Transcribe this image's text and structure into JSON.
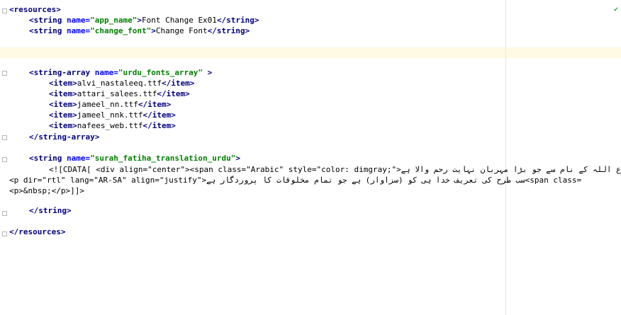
{
  "editor": {
    "lines": [
      {
        "id": "l1",
        "indent": 0,
        "parts": [
          {
            "k": "tag",
            "t": "<resources>"
          }
        ]
      },
      {
        "id": "l2",
        "indent": 4,
        "parts": [
          {
            "k": "tag",
            "t": "<string "
          },
          {
            "k": "attr",
            "t": "name="
          },
          {
            "k": "val",
            "t": "\"app_name\""
          },
          {
            "k": "tag",
            "t": ">"
          },
          {
            "k": "txt",
            "t": "Font Change Ex01"
          },
          {
            "k": "tag",
            "t": "</string>"
          }
        ]
      },
      {
        "id": "l3",
        "indent": 4,
        "parts": [
          {
            "k": "tag",
            "t": "<string "
          },
          {
            "k": "attr",
            "t": "name="
          },
          {
            "k": "val",
            "t": "\"change_font\""
          },
          {
            "k": "tag",
            "t": ">"
          },
          {
            "k": "txt",
            "t": "Change Font"
          },
          {
            "k": "tag",
            "t": "</string>"
          }
        ]
      },
      {
        "id": "l4",
        "indent": 0,
        "parts": []
      },
      {
        "id": "l5",
        "indent": 0,
        "parts": []
      },
      {
        "id": "l6",
        "indent": 0,
        "parts": []
      },
      {
        "id": "l7",
        "indent": 4,
        "parts": [
          {
            "k": "tag",
            "t": "<string-array "
          },
          {
            "k": "attr",
            "t": "name="
          },
          {
            "k": "val",
            "t": "\"urdu_fonts_array\""
          },
          {
            "k": "tag",
            "t": " >"
          }
        ]
      },
      {
        "id": "l8",
        "indent": 8,
        "parts": [
          {
            "k": "tag",
            "t": "<item>"
          },
          {
            "k": "txt",
            "t": "alvi_nastaleeq.ttf"
          },
          {
            "k": "tag",
            "t": "</item>"
          }
        ]
      },
      {
        "id": "l9",
        "indent": 8,
        "parts": [
          {
            "k": "tag",
            "t": "<item>"
          },
          {
            "k": "txt",
            "t": "attari_salees.ttf"
          },
          {
            "k": "tag",
            "t": "</item>"
          }
        ]
      },
      {
        "id": "l10",
        "indent": 8,
        "parts": [
          {
            "k": "tag",
            "t": "<item>"
          },
          {
            "k": "txt",
            "t": "jameel_nn.ttf"
          },
          {
            "k": "tag",
            "t": "</item>"
          }
        ]
      },
      {
        "id": "l11",
        "indent": 8,
        "parts": [
          {
            "k": "tag",
            "t": "<item>"
          },
          {
            "k": "txt",
            "t": "jameel_nnk.ttf"
          },
          {
            "k": "tag",
            "t": "</item>"
          }
        ]
      },
      {
        "id": "l12",
        "indent": 8,
        "parts": [
          {
            "k": "tag",
            "t": "<item>"
          },
          {
            "k": "txt",
            "t": "nafees_web.ttf"
          },
          {
            "k": "tag",
            "t": "</item>"
          }
        ]
      },
      {
        "id": "l13",
        "indent": 4,
        "parts": [
          {
            "k": "tag",
            "t": "</string-array>"
          }
        ]
      },
      {
        "id": "l14",
        "indent": 0,
        "parts": []
      },
      {
        "id": "l15",
        "indent": 4,
        "parts": [
          {
            "k": "tag",
            "t": "<string "
          },
          {
            "k": "attr",
            "t": "name="
          },
          {
            "k": "val",
            "t": "\"surah_fatiha_translation_urdu\""
          },
          {
            "k": "tag",
            "t": ">"
          }
        ]
      },
      {
        "id": "l16",
        "indent": 8,
        "parts": [
          {
            "k": "txt",
            "t": "<![CDATA[ <div align=\"center\"><span class=\"Arabic\" style=\"color: dimgray;\">"
          },
          {
            "k": "txt",
            "t": "شروع اللہ کے نام سے جو بڑا مہربان نہایت رحم والا ہے"
          }
        ]
      },
      {
        "id": "l17",
        "indent": 0,
        "parts": [
          {
            "k": "txt",
            "t": "<p dir=\"rtl\" lang=\"AR-SA\" align=\"justify\">"
          },
          {
            "k": "txt",
            "t": "سب طرح کی تعریف خدا ہی کو (سزاوار) ہے جو تمام مخلوقات کا پروردگار ہے"
          },
          {
            "k": "txt",
            "t": "<span class="
          }
        ]
      },
      {
        "id": "l18",
        "indent": 0,
        "parts": [
          {
            "k": "txt",
            "t": "<p>&nbsp;</p>]]>"
          }
        ]
      },
      {
        "id": "l19",
        "indent": 0,
        "parts": []
      },
      {
        "id": "l20",
        "indent": 4,
        "parts": [
          {
            "k": "tag",
            "t": "</string>"
          }
        ]
      },
      {
        "id": "l21",
        "indent": 0,
        "parts": []
      },
      {
        "id": "l22",
        "indent": 0,
        "parts": [
          {
            "k": "tag",
            "t": "</resources>"
          }
        ]
      }
    ]
  },
  "colors": {
    "tag": "#000080",
    "attr": "#0000ff",
    "value": "#008000",
    "current_line": "#fffae3"
  },
  "icons": {
    "top_right": "checkmark-icon"
  }
}
